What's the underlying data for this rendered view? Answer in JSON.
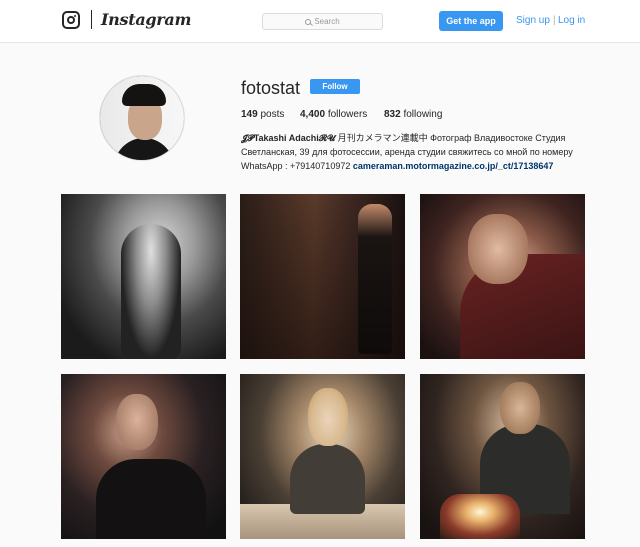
{
  "header": {
    "brand": "Instagram",
    "search_placeholder": "Search",
    "get_app_label": "Get the app",
    "signup_label": "Sign up",
    "separator": "|",
    "login_label": "Log in"
  },
  "profile": {
    "username": "fotostat",
    "follow_label": "Follow",
    "stats": {
      "posts_count": "149",
      "posts_label": "posts",
      "followers_count": "4,400",
      "followers_label": "followers",
      "following_count": "832",
      "following_label": "following"
    },
    "bio": {
      "name": "𝓙𝓟Takashi Adachi𝓡𝓤",
      "text": " 月刊カメラマン連載中 Фотограф Владивостоке Студия Светланская, 39 для фотосессии, аренда студии свяжитесь со мной по номеру WhatsApp : +79140710972 ",
      "link": "cameraman.motormagazine.co.jp/_ct/17138647"
    }
  },
  "posts": [
    {
      "alt": "black and white portrait of woman in black dress"
    },
    {
      "alt": "woman in black outfit in dark corridor"
    },
    {
      "alt": "woman with long wavy hair in burgundy top"
    },
    {
      "alt": "woman in black off-shoulder dress with red lips"
    },
    {
      "alt": "blonde woman in grey sweater by Christmas tree"
    },
    {
      "alt": "woman with candles at holiday table"
    }
  ]
}
